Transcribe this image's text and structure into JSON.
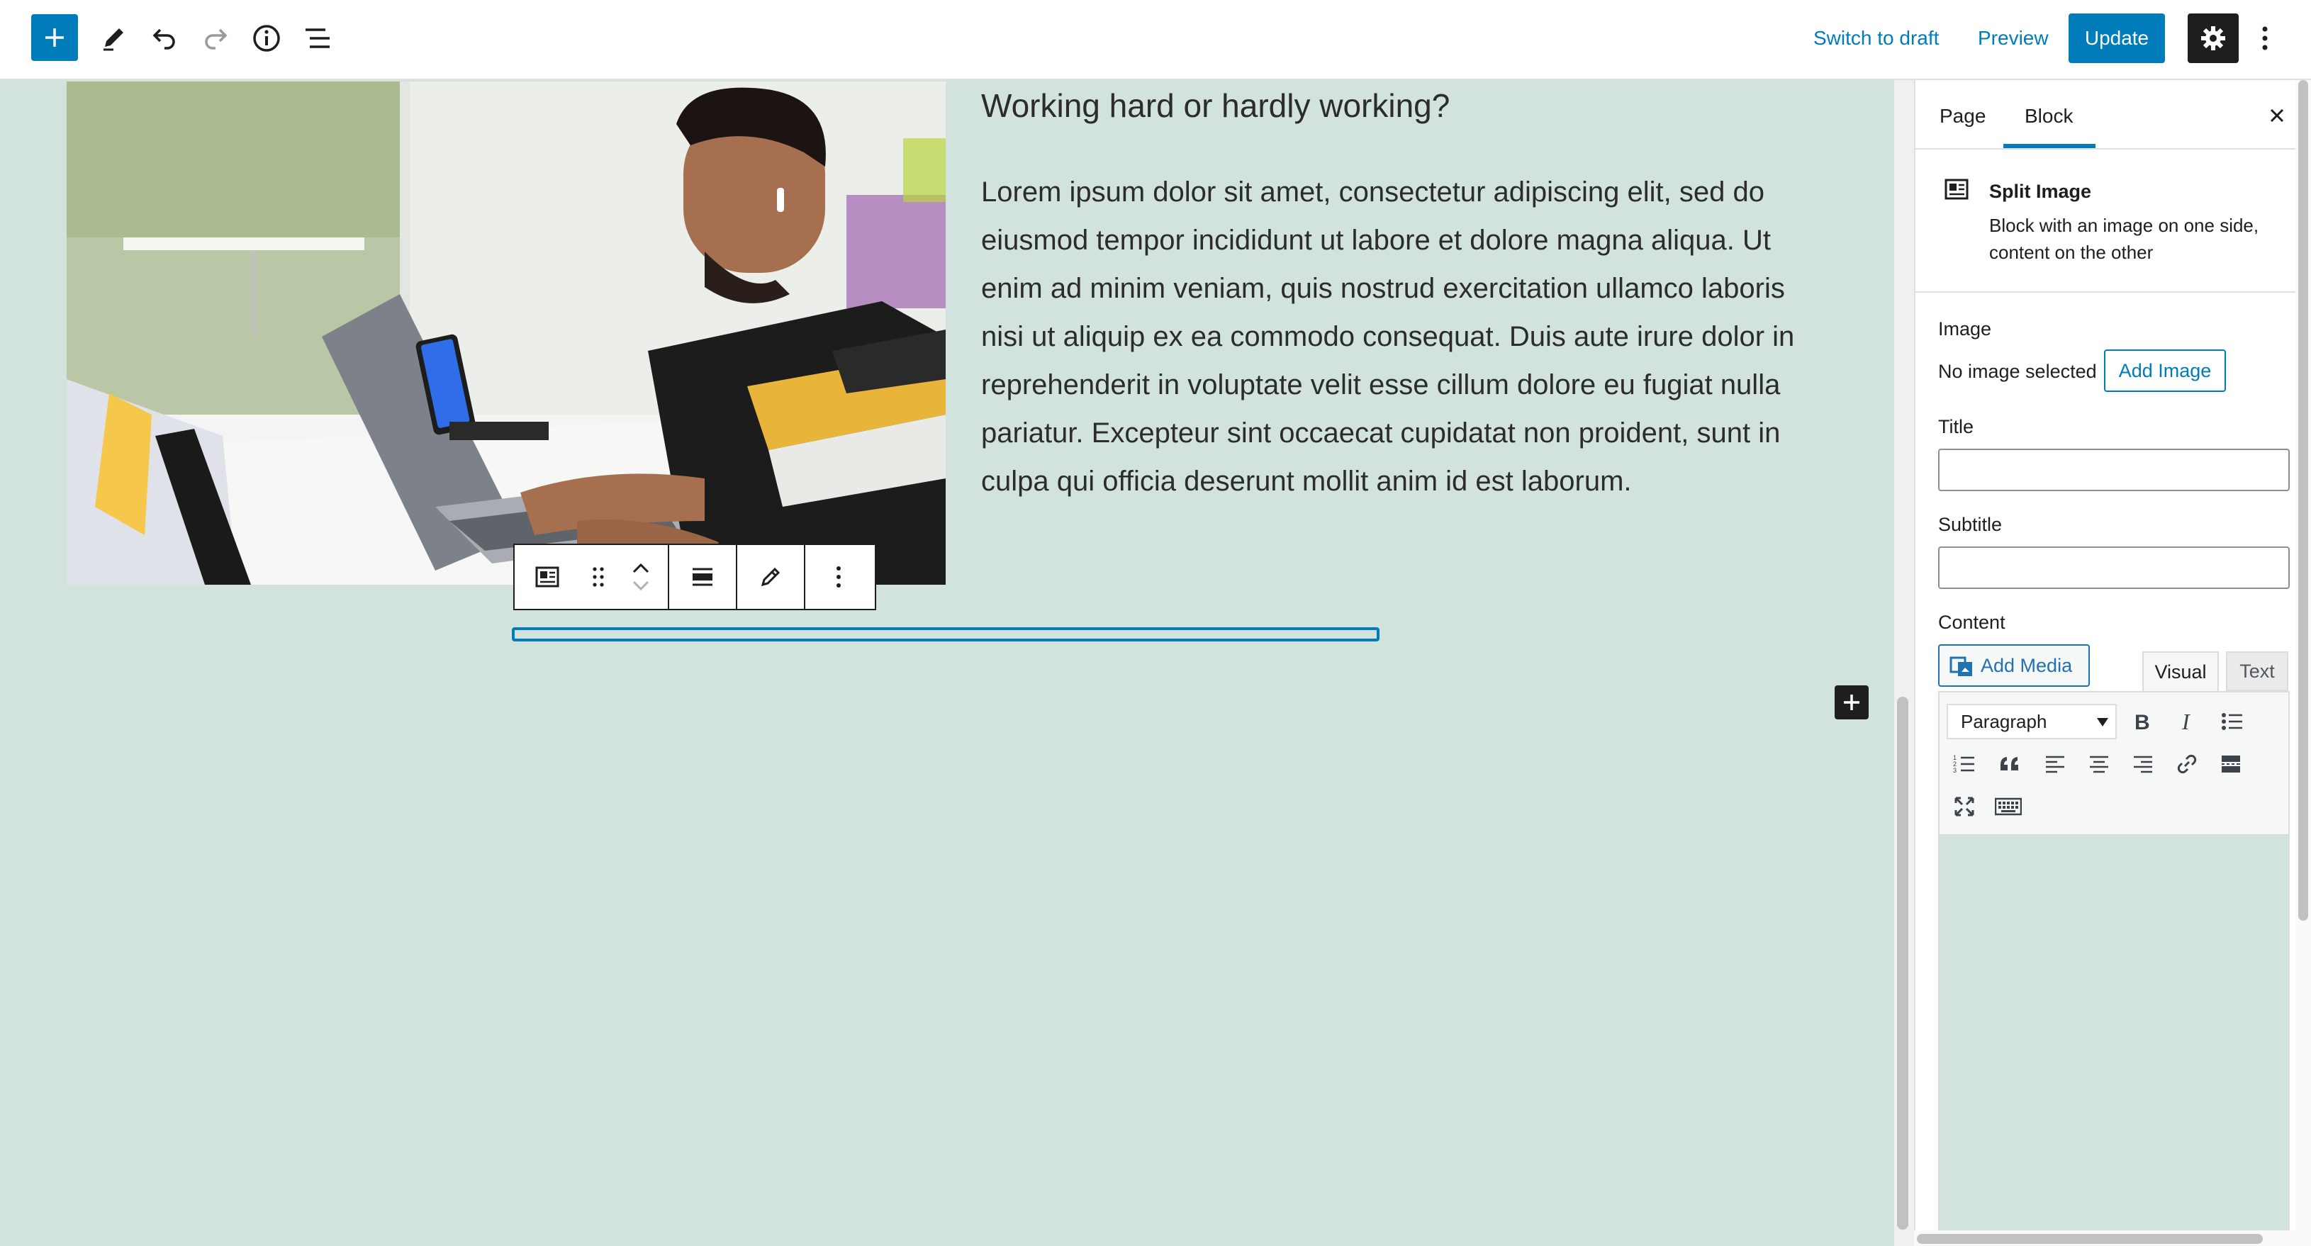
{
  "topbar": {
    "switch_to_draft": "Switch to draft",
    "preview": "Preview",
    "update": "Update"
  },
  "content": {
    "heading": "Working hard or hardly working?",
    "paragraph": "Lorem ipsum dolor sit amet, consectetur adipiscing elit, sed do eiusmod tempor incididunt ut labore et dolore magna aliqua. Ut enim ad minim veniam, quis nostrud exercitation ullamco laboris nisi ut aliquip ex ea commodo consequat. Duis aute irure dolor in reprehenderit in voluptate velit esse cillum dolore eu fugiat nulla pariatur. Excepteur sint occaecat cupidatat non proident, sunt in culpa qui officia deserunt mollit anim id est laborum."
  },
  "sidebar": {
    "tabs": [
      "Page",
      "Block"
    ],
    "active_tab": "Block",
    "block_card": {
      "title": "Split Image",
      "description": "Block with an image on one side, content on the other"
    },
    "image_label": "Image",
    "no_image_text": "No image selected",
    "add_image_label": "Add Image",
    "title_label": "Title",
    "title_value": "",
    "subtitle_label": "Subtitle",
    "subtitle_value": "",
    "content_label": "Content",
    "add_media_label": "Add Media",
    "editor_tabs": [
      "Visual",
      "Text"
    ],
    "format_select": "Paragraph"
  },
  "colors": {
    "accent": "#007cba",
    "canvas_bg": "#d2e3dd",
    "dark": "#1e1e1e"
  }
}
